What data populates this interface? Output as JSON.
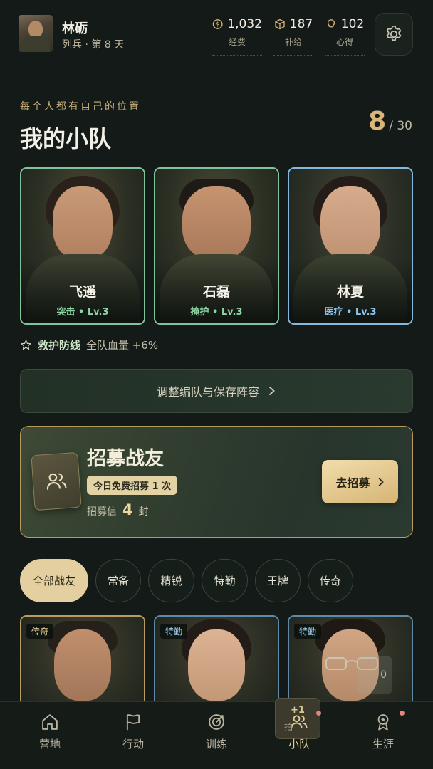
{
  "player": {
    "name": "林砺",
    "rank_day": "列兵 · 第 8 天"
  },
  "resources": [
    {
      "icon": "coin-icon",
      "value": "1,032",
      "label": "经费"
    },
    {
      "icon": "box-icon",
      "value": "187",
      "label": "补给"
    },
    {
      "icon": "bulb-icon",
      "value": "102",
      "label": "心得"
    }
  ],
  "squad": {
    "eyebrow": "每个人都有自己的位置",
    "title": "我的小队",
    "count": "8",
    "capacity": "/ 30",
    "members": [
      {
        "name": "飞遥",
        "role": "突击 • Lv.3",
        "color": "#7fc49a"
      },
      {
        "name": "石磊",
        "role": "掩护 • Lv.3",
        "color": "#7fc49a"
      },
      {
        "name": "林夏",
        "role": "医疗 • Lv.3",
        "color": "#84b9dd"
      }
    ],
    "bonus_name": "救护防线",
    "bonus_text": "全队血量 +6%",
    "adjust_label": "调整编队与保存阵容"
  },
  "recruit": {
    "title": "招募战友",
    "badge": "今日免费招募 1 次",
    "letter_label": "招募信",
    "letter_count": "4",
    "letter_unit": "封",
    "button": "去招募"
  },
  "filters": [
    "全部战友",
    "常备",
    "精锐",
    "特勤",
    "王牌",
    "传奇"
  ],
  "roster": [
    {
      "tier": "传奇"
    },
    {
      "tier": "特勤"
    },
    {
      "tier": "特勤"
    }
  ],
  "ghost_digit": "0",
  "nav": {
    "items": [
      "营地",
      "行动",
      "训练",
      "小队",
      "生涯"
    ],
    "active": "小队",
    "badge_plus": "+1",
    "overlap_text": "拍"
  }
}
